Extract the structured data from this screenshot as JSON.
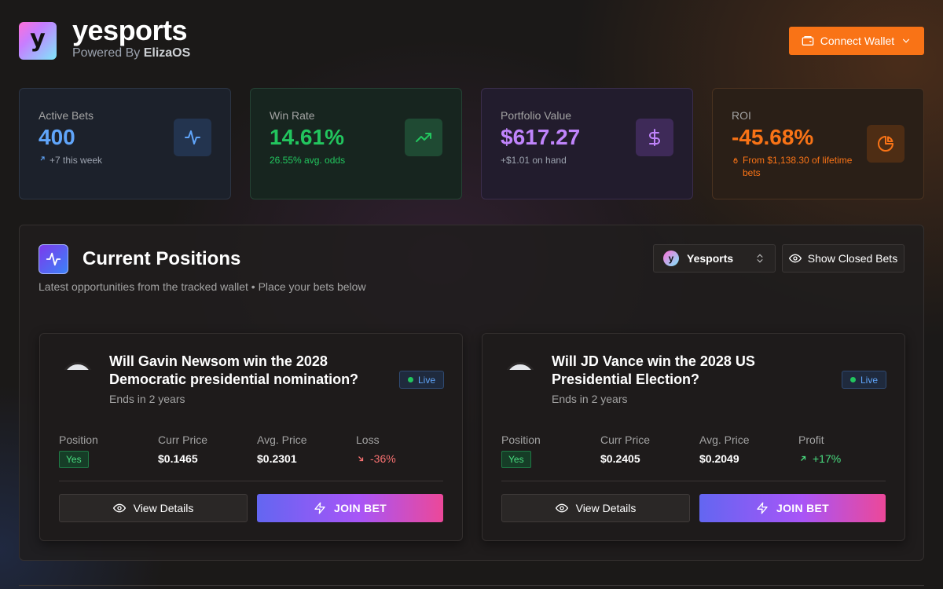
{
  "header": {
    "logo_letter": "y",
    "brand": "yesports",
    "powered_prefix": "Powered By",
    "powered_name": "ElizaOS",
    "connect_label": "Connect Wallet"
  },
  "stats": [
    {
      "label": "Active Bets",
      "value": "400",
      "sub": "+7 this week",
      "icon": "activity-icon"
    },
    {
      "label": "Win Rate",
      "value": "14.61%",
      "sub": "26.55% avg. odds",
      "icon": "trending-up-icon"
    },
    {
      "label": "Portfolio Value",
      "value": "$617.27",
      "sub": "+$1.01 on hand",
      "icon": "dollar-icon"
    },
    {
      "label": "ROI",
      "value": "-45.68%",
      "sub": "From $1,138.30 of lifetime bets",
      "icon": "pie-chart-icon"
    }
  ],
  "positions": {
    "title": "Current Positions",
    "subtitle": "Latest opportunities from the tracked wallet • Place your bets below",
    "wallet_select": "Yesports",
    "wallet_logo_letter": "y",
    "show_closed_label": "Show Closed Bets",
    "headers": {
      "position": "Position",
      "curr_price": "Curr Price",
      "avg_price": "Avg. Price"
    },
    "live_label": "Live",
    "view_details_label": "View Details",
    "join_label": "JOIN BET",
    "cards": [
      {
        "title": "Will Gavin Newsom win the 2028 Democratic presidential nomination?",
        "ends": "Ends in 2 years",
        "position": "Yes",
        "curr_price": "$0.1465",
        "avg_price": "$0.2301",
        "pl_label": "Loss",
        "pl_value": "-36%"
      },
      {
        "title": "Will JD Vance win the 2028 US Presidential Election?",
        "ends": "Ends in 2 years",
        "position": "Yes",
        "curr_price": "$0.2405",
        "avg_price": "$0.2049",
        "pl_label": "Profit",
        "pl_value": "+17%"
      }
    ]
  },
  "colors": {
    "accent_orange": "#f97316",
    "blue": "#60a5fa",
    "green": "#22c55e",
    "purple": "#c084fc",
    "loss_red": "#f87171"
  }
}
